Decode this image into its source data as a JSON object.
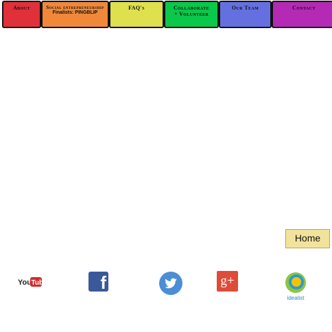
{
  "nav": {
    "tabs": [
      {
        "label": "About"
      },
      {
        "label": "Social entrepreneurship",
        "label2": "Finalists: PINGBLIP"
      },
      {
        "label": "FAQ's"
      },
      {
        "label": "Collaborate",
        "label2": "+ Volunteer"
      },
      {
        "label": "Our Team"
      },
      {
        "label": "Contact"
      }
    ]
  },
  "home_button": {
    "label": "Home"
  },
  "social": {
    "youtube": {
      "label": "YouTube",
      "icon": "youtube-icon"
    },
    "facebook": {
      "label": "f",
      "icon": "facebook-icon"
    },
    "twitter": {
      "icon": "twitter-icon"
    },
    "googleplus": {
      "label": "g+",
      "icon": "google-plus-icon"
    },
    "idealist": {
      "label": "idealist",
      "icon": "idealist-icon"
    }
  }
}
